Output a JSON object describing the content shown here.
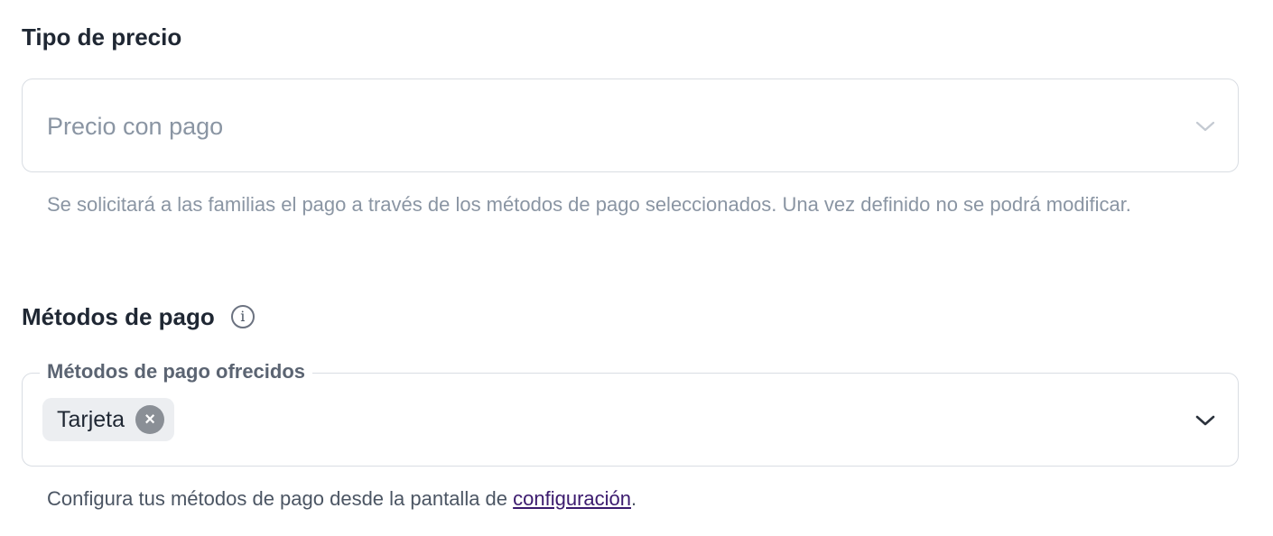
{
  "price_type": {
    "title": "Tipo de precio",
    "select_value": "Precio con pago",
    "helper": "Se solicitará a las familias el pago a través de los métodos de pago seleccionados. Una vez definido no se podrá modificar."
  },
  "payment_methods": {
    "title": "Métodos de pago",
    "info_glyph": "i",
    "field_label": "Métodos de pago ofrecidos",
    "chips": [
      {
        "label": "Tarjeta",
        "remove_glyph": "×"
      }
    ],
    "helper_prefix": "Configura tus métodos de pago desde la pantalla de ",
    "helper_link": "configuración",
    "helper_suffix": "."
  },
  "colors": {
    "text": "#1f2733",
    "muted": "#8a95a3",
    "border": "#d9dde3",
    "chip_bg": "#eceef1",
    "link": "#3b1a6e"
  },
  "icons": {
    "select_chevron": "chevron-down-icon",
    "info": "info-icon",
    "chip_remove": "close-icon"
  }
}
